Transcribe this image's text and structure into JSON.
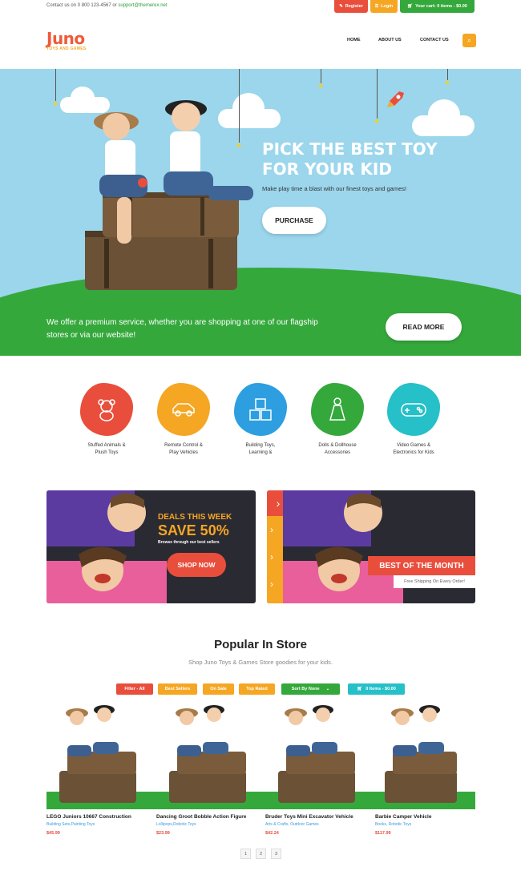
{
  "topbar": {
    "contact_prefix": "Contact us on 0 800 123-4567 or",
    "email": "support@themerex.net",
    "register": "Register",
    "login": "Login",
    "cart": "Your cart: 0 items - $0.00"
  },
  "header": {
    "logo_main": "Juno",
    "logo_sub": "TOYS AND GAMES",
    "nav": [
      "HOME",
      "ABOUT US",
      "CONTACT US"
    ]
  },
  "hero": {
    "title_line1": "PICK THE BEST TOY",
    "title_line2": "FOR YOUR KID",
    "subtitle": "Make play time a blast with our finest toys and games!",
    "cta": "PURCHASE"
  },
  "offer": {
    "line1": "We offer a premium service, whether you are shopping at one of our flagship",
    "line2": "stores or via our website!",
    "cta": "READ MORE"
  },
  "categories": [
    {
      "line1": "Stuffed Animals &",
      "line2": "Plush Toys",
      "color": "#e94e3c",
      "icon": "teddy-bear-icon"
    },
    {
      "line1": "Remote Control &",
      "line2": "Play Vehicles",
      "color": "#f5a623",
      "icon": "car-icon"
    },
    {
      "line1": "Building Toys,",
      "line2": "Learning &",
      "color": "#2d9fe0",
      "icon": "blocks-icon"
    },
    {
      "line1": "Dolls & Dollhouse",
      "line2": "Accessories",
      "color": "#35a83c",
      "icon": "doll-icon"
    },
    {
      "line1": "Video Games &",
      "line2": "Electronics for Kids",
      "color": "#25c0c8",
      "icon": "gamepad-icon"
    }
  ],
  "promo1": {
    "line1": "DEALS THIS WEEK",
    "line2": "SAVE 50%",
    "line3": "Browse through our best sellers",
    "cta": "SHOP NOW"
  },
  "promo2": {
    "title": "BEST OF THE MONTH",
    "sub": "Free Shipping On Every Order!"
  },
  "popular": {
    "title": "Popular In Store",
    "subtitle": "Shop Juno Toys & Games Store goodies for your kids."
  },
  "filters": {
    "all": "Filter - All",
    "best": "Best Sellers",
    "sale": "On Sale",
    "top": "Top Rated",
    "sort": "Sort By None",
    "cart": "0 Items - $0.00"
  },
  "products": [
    {
      "name": "LEGO Juniors 10667 Construction",
      "cat": "Building Sets,Painting Toys",
      "price": "$45.99"
    },
    {
      "name": "Dancing Groot Bobble Action Figure",
      "cat": "Lollipops,Robotic Toys",
      "price": "$23.99"
    },
    {
      "name": "Bruder Toys Mini Excavator Vehicle",
      "cat": "Arts & Crafts, Outdoor Games",
      "price": "$42.24"
    },
    {
      "name": "Barbie Camper Vehicle",
      "cat": "Books, Robotic Toys",
      "price": "$117.99"
    }
  ],
  "pagination": [
    "1",
    "2",
    "3"
  ]
}
